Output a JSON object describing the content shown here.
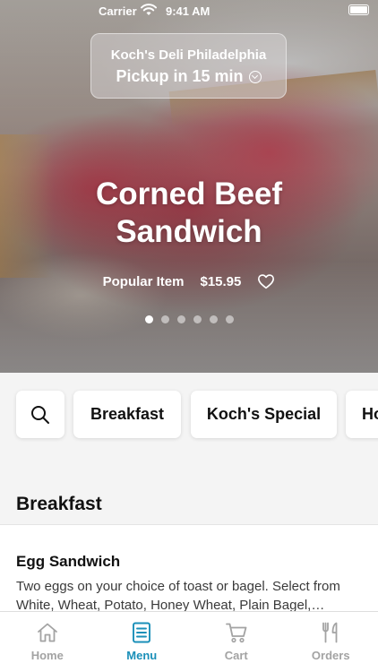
{
  "status_bar": {
    "carrier": "Carrier",
    "time": "9:41 AM"
  },
  "pickup": {
    "store": "Koch's Deli Philadelphia",
    "time": "Pickup in 15 min"
  },
  "hero": {
    "title_line1": "Corned Beef",
    "title_line2": "Sandwich",
    "tag": "Popular Item",
    "price": "$15.95",
    "slides": 6,
    "active_slide": 1
  },
  "categories": [
    "Breakfast",
    "Koch's Special",
    "Ho"
  ],
  "section": {
    "title": "Breakfast"
  },
  "item": {
    "name": "Egg Sandwich",
    "description": "Two eggs on your choice of toast or bagel. Select from White, Wheat, Potato, Honey Wheat, Plain Bagel, Sesame Bagel"
  },
  "tabs": [
    {
      "label": "Home",
      "icon": "home-icon",
      "active": false
    },
    {
      "label": "Menu",
      "icon": "menu-icon",
      "active": true
    },
    {
      "label": "Cart",
      "icon": "cart-icon",
      "active": false
    },
    {
      "label": "Orders",
      "icon": "orders-icon",
      "active": false
    }
  ],
  "colors": {
    "accent": "#1a8fb8",
    "inactive": "#a3a3a3"
  }
}
